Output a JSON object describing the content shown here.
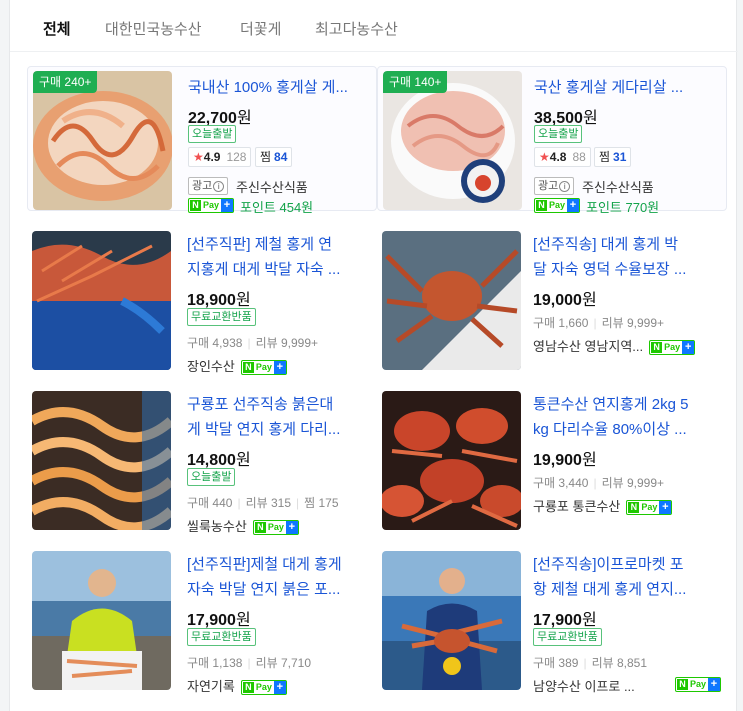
{
  "tabs": [
    {
      "label": "전체",
      "active": true
    },
    {
      "label": "대한민국농수산",
      "active": false
    },
    {
      "label": "더꽃게",
      "active": false
    },
    {
      "label": "최고다농수산",
      "active": false
    }
  ],
  "npay": {
    "n": "N",
    "pay": "Pay",
    "plus": "+"
  },
  "cards": [
    {
      "badge": "구매 240+",
      "title": "국내산 100% 홍게살 게...",
      "price": "22,700",
      "won": "원",
      "tag": "오늘출발",
      "rating": "4.9",
      "rating_count": "128",
      "jjim_label": "찜",
      "jjim_count": "84",
      "ad_label": "광고",
      "seller": "주신수산식품",
      "point": "포인트 454원"
    },
    {
      "badge": "구매 140+",
      "title": "국산 홍게살 게다리살 ...",
      "price": "38,500",
      "won": "원",
      "tag": "오늘출발",
      "rating": "4.8",
      "rating_count": "88",
      "jjim_label": "찜",
      "jjim_count": "31",
      "ad_label": "광고",
      "seller": "주신수산식품",
      "point": "포인트 770원"
    },
    {
      "title_l1": "[선주직판] 제철 홍게 연",
      "title_l2": "지홍게 대게 박달 자숙 ...",
      "price": "18,900",
      "won": "원",
      "tag": "무료교환반품",
      "meta": [
        "구매 4,938",
        "리뷰 9,999+"
      ],
      "seller": "장인수산"
    },
    {
      "title_l1": "[선주직송] 대게 홍게 박",
      "title_l2": "달 자숙 영덕 수율보장 ...",
      "price": "19,000",
      "won": "원",
      "meta": [
        "구매 1,660",
        "리뷰 9,999+"
      ],
      "seller": "영남수산 영남지역..."
    },
    {
      "title_l1": "구룡포 선주직송 붉은대",
      "title_l2": "게 박달 연지 홍게 다리...",
      "price": "14,800",
      "won": "원",
      "tag": "오늘출발",
      "meta": [
        "구매 440",
        "리뷰 315",
        "찜 175"
      ],
      "seller": "씰룩농수산"
    },
    {
      "title_l1": "통큰수산 연지홍게 2kg 5",
      "title_l2": "kg 다리수율 80%이상 ...",
      "price": "19,900",
      "won": "원",
      "meta": [
        "구매 3,440",
        "리뷰 9,999+"
      ],
      "seller": "구룡포 통큰수산"
    },
    {
      "title_l1": "[선주직판]제철 대게 홍게",
      "title_l2": "자숙 박달 연지 붉은 포...",
      "price": "17,900",
      "won": "원",
      "tag": "무료교환반품",
      "meta": [
        "구매 1,138",
        "리뷰 7,710"
      ],
      "seller": "자연기록"
    },
    {
      "title_l1": "[선주직송]이프로마켓 포",
      "title_l2": "항 제철 대게 홍게 연지...",
      "price": "17,900",
      "won": "원",
      "tag": "무료교환반품",
      "meta": [
        "구매 389",
        "리뷰 8,851"
      ],
      "seller": "남양수산 이프로 ..."
    }
  ],
  "colors": {
    "accent_green": "#1fae52",
    "link_blue": "#1a55d6",
    "npay_green": "#1ec800"
  }
}
